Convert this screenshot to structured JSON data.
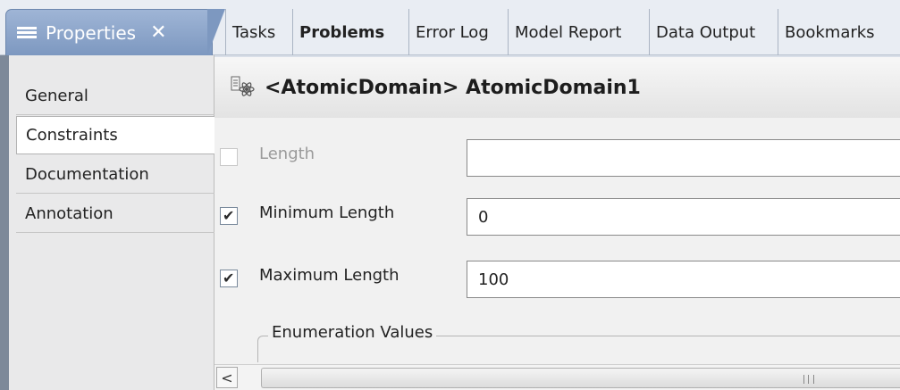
{
  "tabs": {
    "active": {
      "label": "Properties",
      "icon": "properties-list-icon",
      "close": "✕"
    },
    "others": [
      "Tasks",
      "Problems",
      "Error Log",
      "Model Report",
      "Data Output",
      "Bookmarks"
    ]
  },
  "sidebar": {
    "items": [
      {
        "label": "General"
      },
      {
        "label": "Constraints",
        "selected": true
      },
      {
        "label": "Documentation"
      },
      {
        "label": "Annotation"
      }
    ]
  },
  "header": {
    "icon": "atomic-domain-icon",
    "title": "<AtomicDomain> AtomicDomain1"
  },
  "constraints": {
    "length": {
      "label": "Length",
      "checked": false,
      "enabled": false,
      "value": ""
    },
    "min_length": {
      "label": "Minimum Length",
      "checked": true,
      "value": "0"
    },
    "max_length": {
      "label": "Maximum Length",
      "checked": true,
      "value": "100"
    }
  },
  "enumeration": {
    "label": "Enumeration Values"
  },
  "scrollbar": {
    "left_arrow": "<"
  }
}
